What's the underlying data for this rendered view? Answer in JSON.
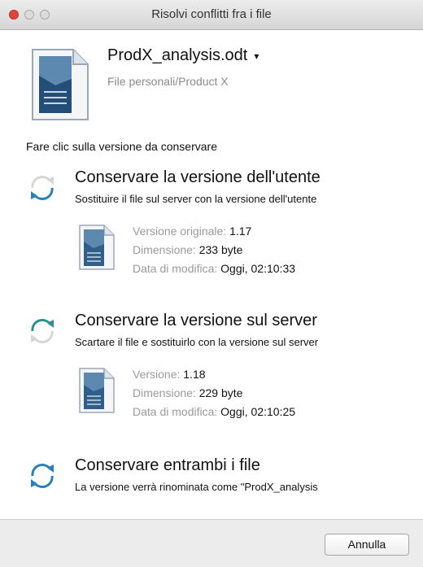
{
  "window": {
    "title": "Risolvi conflitti fra i file",
    "controls": [
      "close",
      "minimize",
      "zoom"
    ]
  },
  "file": {
    "name": "ProdX_analysis.odt",
    "dropdown_caret": "▾",
    "path": "File personali/Product X",
    "icon": "document-icon"
  },
  "instruction": "Fare clic sulla versione da conservare",
  "options": [
    {
      "id": "local",
      "title": "Conservare la versione dell'utente",
      "description": "Sostituire il file sul server con la versione dell'utente",
      "icon": "sync-arrows-icon",
      "icon_color": "#2a7fb8",
      "details": [
        {
          "label": "Versione originale:",
          "value": "1.17"
        },
        {
          "label": "Dimensione:",
          "value": "233 byte"
        },
        {
          "label": "Data di modifica:",
          "value": "Oggi, 02:10:33"
        }
      ]
    },
    {
      "id": "server",
      "title": "Conservare la versione sul server",
      "description": "Scartare il file e sostituirlo con la versione sul server",
      "icon": "sync-arrows-icon",
      "icon_color": "#2f8f8f",
      "details": [
        {
          "label": "Versione:",
          "value": "1.18"
        },
        {
          "label": "Dimensione:",
          "value": "229 byte"
        },
        {
          "label": "Data di modifica:",
          "value": "Oggi, 02:10:25"
        }
      ]
    },
    {
      "id": "both",
      "title": "Conservare entrambi i file",
      "description": "La versione verrà rinominata come \"ProdX_analysis",
      "icon": "sync-arrows-icon",
      "icon_color": "#2a7fb8"
    }
  ],
  "buttons": {
    "cancel": "Annulla"
  }
}
